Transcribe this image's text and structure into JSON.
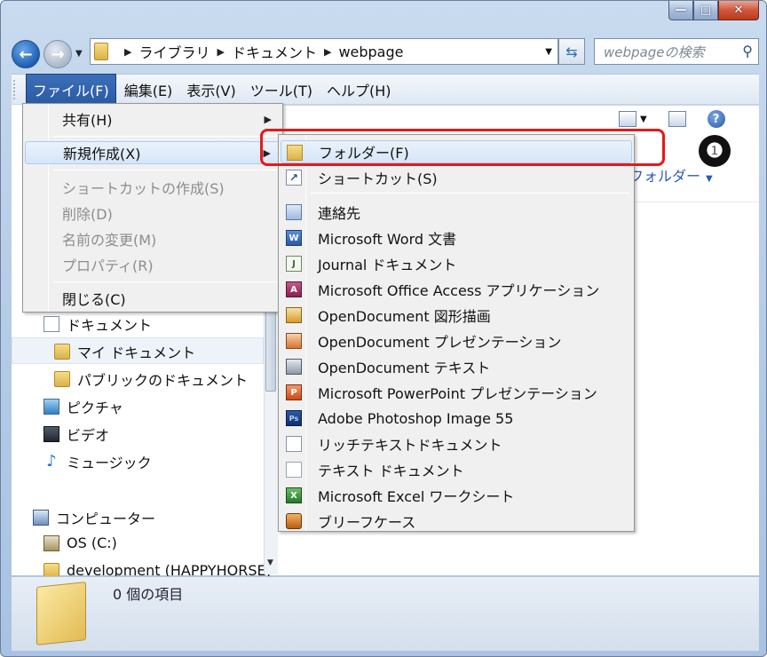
{
  "window": {
    "caption_min": "—",
    "caption_max": "□",
    "caption_close": "✕"
  },
  "address": {
    "crumbs": [
      "ライブラリ",
      "ドキュメント",
      "webpage"
    ],
    "search_placeholder": "webpageの検索"
  },
  "menubar": {
    "items": [
      "ファイル(F)",
      "編集(E)",
      "表示(V)",
      "ツール(T)",
      "ヘルプ(H)"
    ]
  },
  "content": {
    "arrange_label": "フォルダー"
  },
  "file_menu": {
    "items": [
      {
        "label": "共有(H)",
        "enabled": true,
        "submenu": true
      },
      {
        "label": "新規作成(X)",
        "enabled": true,
        "submenu": true,
        "highlighted": true
      },
      {
        "label": "ショートカットの作成(S)",
        "enabled": false
      },
      {
        "label": "削除(D)",
        "enabled": false
      },
      {
        "label": "名前の変更(M)",
        "enabled": false
      },
      {
        "label": "プロパティ(R)",
        "enabled": false
      },
      {
        "label": "閉じる(C)",
        "enabled": true
      }
    ]
  },
  "new_submenu": {
    "items": [
      {
        "label": "フォルダー(F)",
        "icon": "folder-icon",
        "highlighted": true
      },
      {
        "label": "ショートカット(S)",
        "icon": "shortcut-icon"
      },
      {
        "label": "連絡先",
        "icon": "contact-icon"
      },
      {
        "label": "Microsoft Word 文書",
        "icon": "word-icon"
      },
      {
        "label": "Journal ドキュメント",
        "icon": "journal-icon"
      },
      {
        "label": "Microsoft Office Access アプリケーション",
        "icon": "access-icon"
      },
      {
        "label": "OpenDocument 図形描画",
        "icon": "odg-icon"
      },
      {
        "label": "OpenDocument プレゼンテーション",
        "icon": "odp-icon"
      },
      {
        "label": "OpenDocument テキスト",
        "icon": "odt-icon"
      },
      {
        "label": "Microsoft PowerPoint プレゼンテーション",
        "icon": "powerpoint-icon"
      },
      {
        "label": "Adobe Photoshop Image 55",
        "icon": "photoshop-icon"
      },
      {
        "label": "リッチテキストドキュメント",
        "icon": "rtf-icon"
      },
      {
        "label": "テキスト ドキュメント",
        "icon": "text-icon"
      },
      {
        "label": "Microsoft Excel ワークシート",
        "icon": "excel-icon"
      },
      {
        "label": "ブリーフケース",
        "icon": "briefcase-icon"
      }
    ]
  },
  "nav_pane": {
    "items": [
      {
        "label": "ドキュメント",
        "icon": "document-icon"
      },
      {
        "label": "マイ ドキュメント",
        "icon": "folder-icon",
        "selected": true
      },
      {
        "label": "パブリックのドキュメント",
        "icon": "folder-icon"
      },
      {
        "label": "ピクチャ",
        "icon": "pictures-icon"
      },
      {
        "label": "ビデオ",
        "icon": "video-icon"
      },
      {
        "label": "ミュージック",
        "icon": "music-icon"
      },
      {
        "label": "コンピューター",
        "icon": "computer-icon"
      },
      {
        "label": "OS (C:)",
        "icon": "drive-icon"
      },
      {
        "label": "development (HAPPYHORSE)",
        "icon": "folder-icon"
      }
    ]
  },
  "status": {
    "item_count": "0 個の項目"
  },
  "annotation": {
    "number": "❶"
  },
  "colors": {
    "highlight_border": "#e81818",
    "menu_active": "#2a5aa4"
  }
}
